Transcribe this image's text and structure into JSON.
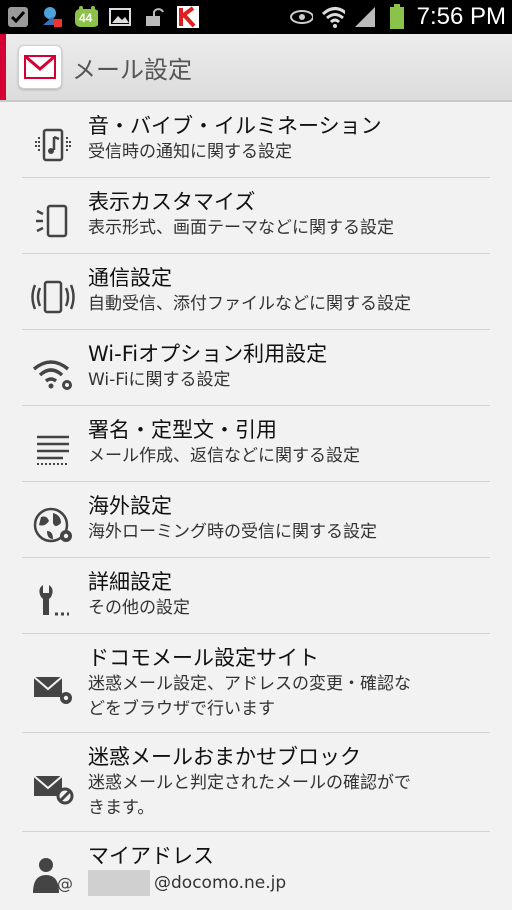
{
  "status_bar": {
    "time": "7:56 PM",
    "icons": [
      "checkbox-icon",
      "sync-icon",
      "android-44-icon",
      "image-icon",
      "unlock-icon",
      "k-app-icon",
      "eye-icon",
      "wifi-icon",
      "signal-icon",
      "battery-icon"
    ],
    "badge": "44"
  },
  "header": {
    "title": "メール設定",
    "accent_color": "#d40033"
  },
  "items": [
    {
      "title": "音・バイブ・イルミネーション",
      "subtitle": "受信時の通知に関する設定",
      "icon": "music-vibrate-icon"
    },
    {
      "title": "表示カスタマイズ",
      "subtitle": "表示形式、画面テーマなどに関する設定",
      "icon": "display-icon"
    },
    {
      "title": "通信設定",
      "subtitle": "自動受信、添付ファイルなどに関する設定",
      "icon": "communication-icon"
    },
    {
      "title": "Wi-Fiオプション利用設定",
      "subtitle": "Wi-Fiに関する設定",
      "icon": "wifi-settings-icon"
    },
    {
      "title": "署名・定型文・引用",
      "subtitle": "メール作成、返信などに関する設定",
      "icon": "signature-icon"
    },
    {
      "title": "海外設定",
      "subtitle": "海外ローミング時の受信に関する設定",
      "icon": "globe-settings-icon"
    },
    {
      "title": "詳細設定",
      "subtitle": "その他の設定",
      "icon": "wrench-icon"
    },
    {
      "title": "ドコモメール設定サイト",
      "subtitle_line1": "迷惑メール設定、アドレスの変更・確認な",
      "subtitle_line2": "どをブラウザで行います",
      "icon": "mail-settings-icon"
    },
    {
      "title": "迷惑メールおまかせブロック",
      "subtitle_line1": "迷惑メールと判定されたメールの確認がで",
      "subtitle_line2": "きます。",
      "icon": "mail-block-icon"
    },
    {
      "title": "マイアドレス",
      "subtitle": "@docomo.ne.jp",
      "icon": "person-at-icon"
    }
  ]
}
